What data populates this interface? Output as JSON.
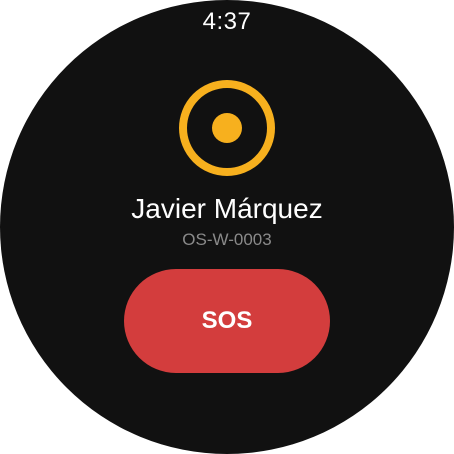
{
  "status_bar": {
    "time": "4:37"
  },
  "status": {
    "icon": "location-target-icon",
    "color": "#f7b01e"
  },
  "user": {
    "name": "Javier Márquez",
    "device_id": "OS-W-0003"
  },
  "actions": {
    "sos_label": "SOS",
    "sos_color": "#d33d3d"
  }
}
